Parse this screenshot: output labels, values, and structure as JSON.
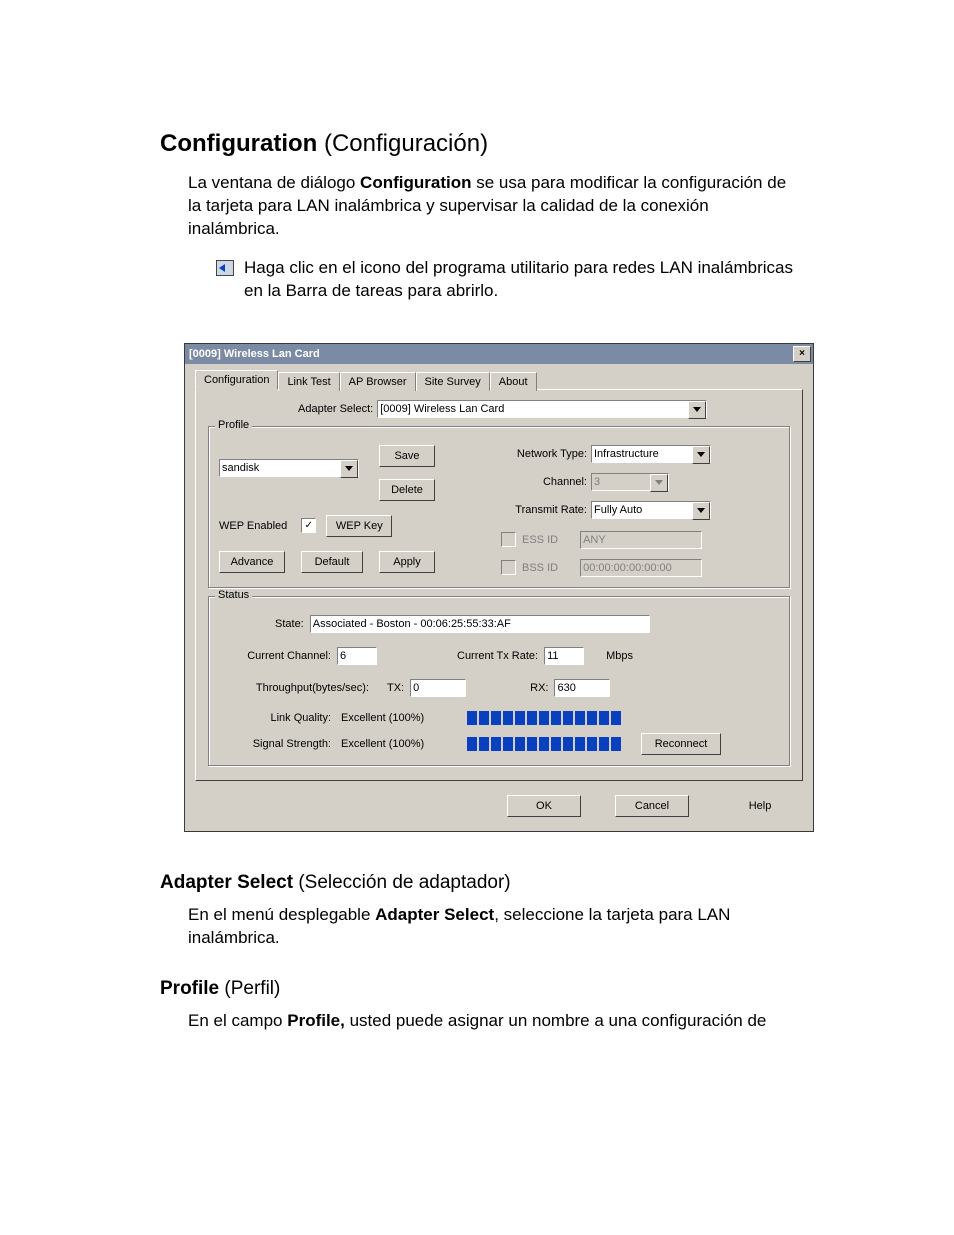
{
  "doc": {
    "h1_bold": "Configuration",
    "h1_rest": " (Configuración)",
    "intro_a": "La ventana de diálogo ",
    "intro_b": "Configuration",
    "intro_c": " se usa para modificar la configuración de la tarjeta para LAN inalámbrica y supervisar la calidad de la conexión inalámbrica.",
    "bullet_a": "Haga clic en el icono del programa utilitario para redes LAN inalámbricas en la ",
    "bullet_b": "Barra de tareas",
    "bullet_c": " para abrirlo.",
    "h2a_bold": "Adapter Select",
    "h2a_rest": " (Selección de adaptador)",
    "p2_a": "En el menú desplegable ",
    "p2_b": "Adapter Select",
    "p2_c": ", seleccione la tarjeta para LAN inalámbrica.",
    "h2b_bold": "Profile",
    "h2b_rest": " (Perfil)",
    "p3_a": "En el campo ",
    "p3_b": "Profile,",
    "p3_c": " usted puede asignar un nombre a una configuración de"
  },
  "dlg": {
    "title": "[0009] Wireless Lan Card",
    "close": "×",
    "tabs": [
      "Configuration",
      "Link Test",
      "AP Browser",
      "Site Survey",
      "About"
    ],
    "adapter_label": "Adapter Select:",
    "adapter_value": "[0009] Wireless Lan Card",
    "profile_legend": "Profile",
    "profile_value": "sandisk",
    "save": "Save",
    "delete": "Delete",
    "wep_enabled": "WEP Enabled",
    "wep_check": "✓",
    "wep_key": "WEP Key",
    "advance": "Advance",
    "default": "Default",
    "apply": "Apply",
    "network_type_lbl": "Network Type:",
    "network_type_val": "Infrastructure",
    "channel_lbl": "Channel:",
    "channel_val": "3",
    "txrate_lbl": "Transmit Rate:",
    "txrate_val": "Fully Auto",
    "essid_lbl": "ESS ID",
    "essid_val": "ANY",
    "bssid_lbl": "BSS ID",
    "bssid_val": "00:00:00:00:00:00",
    "status_legend": "Status",
    "state_lbl": "State:",
    "state_val": "Associated - Boston - 00:06:25:55:33:AF",
    "curr_ch_lbl": "Current Channel:",
    "curr_ch_val": "6",
    "curr_tx_lbl": "Current Tx Rate:",
    "curr_tx_val": "11",
    "mbps": "Mbps",
    "thr_lbl": "Throughput(bytes/sec):",
    "tx_lbl": "TX:",
    "tx_val": "0",
    "rx_lbl": "RX:",
    "rx_val": "630",
    "lq_lbl": "Link Quality:",
    "lq_val": "Excellent (100%)",
    "ss_lbl": "Signal Strength:",
    "ss_val": "Excellent (100%)",
    "reconnect": "Reconnect",
    "ok": "OK",
    "cancel": "Cancel",
    "help": "Help"
  }
}
